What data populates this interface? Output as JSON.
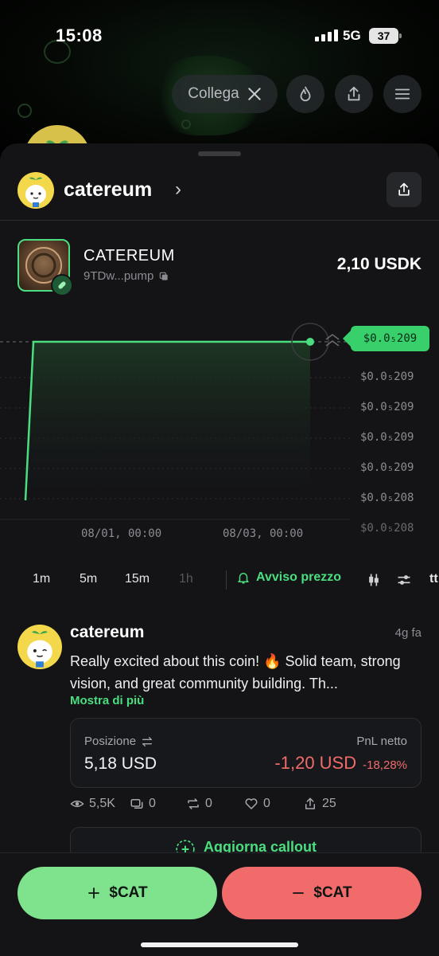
{
  "status_bar": {
    "time": "15:08",
    "network": "5G",
    "battery": "37"
  },
  "top_actions": {
    "connect_label": "Collega",
    "connect_icon": "x-logo-icon"
  },
  "profile": {
    "name": "catereum"
  },
  "token": {
    "name": "CATEREUM",
    "address": "9TDw...pump",
    "value": "2,10 USDK"
  },
  "chart_data": {
    "type": "line",
    "current_price_label": "$0.0₅209",
    "y_ticks": [
      "$0.0₅209",
      "$0.0₅209",
      "$0.0₅209",
      "$0.0₅209",
      "$0.0₅208",
      "$0.0₅208"
    ],
    "x_ticks": [
      "08/01, 00:00",
      "08/03, 00:00"
    ],
    "accent_color": "#4ade80"
  },
  "timeframes": {
    "items": [
      {
        "label": "1m",
        "disabled": false
      },
      {
        "label": "5m",
        "disabled": false
      },
      {
        "label": "15m",
        "disabled": false
      },
      {
        "label": "1h",
        "disabled": true
      }
    ],
    "alert_label": "Avviso prezzo",
    "extra_label": "tt"
  },
  "post": {
    "author": "catereum",
    "time_ago": "4g fa",
    "text": "Really excited about this coin! 🔥 Solid team, strong vision, and great community building. Th...",
    "show_more": "Mostra di più",
    "position_label": "Posizione",
    "position_value": "5,18 USD",
    "pnl_label": "PnL netto",
    "pnl_value": "-1,20 USD",
    "pnl_pct": "-18,28%",
    "stats": {
      "views": "5,5K",
      "comments": "0",
      "reposts": "0",
      "likes": "0",
      "shares": "25"
    },
    "callout_label": "Aggiorna callout"
  },
  "actions": {
    "buy_label": "$CAT",
    "sell_label": "$CAT"
  },
  "colors": {
    "accent": "#4ade80",
    "negative": "#f26b6b",
    "buy": "#7ee38c",
    "sell": "#f26b6b"
  }
}
